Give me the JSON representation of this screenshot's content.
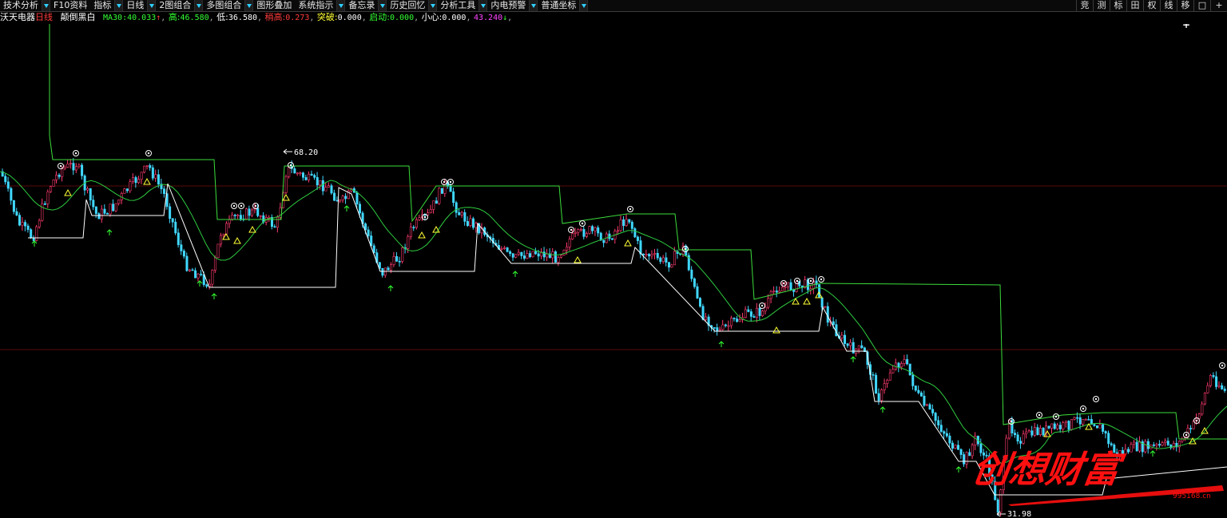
{
  "menu": [
    {
      "label": "技术分析",
      "dd": true
    },
    {
      "label": "F10资料",
      "dd": false
    },
    {
      "label": "指标",
      "dd": true
    },
    {
      "label": "日线",
      "dd": true
    },
    {
      "label": "2图组合",
      "dd": true
    },
    {
      "label": "多图组合",
      "dd": true
    },
    {
      "label": "图形叠加",
      "dd": false
    },
    {
      "label": "系统指示",
      "dd": true
    },
    {
      "label": "备忘录",
      "dd": true
    },
    {
      "label": "历史回忆",
      "dd": true
    },
    {
      "label": "分析工具",
      "dd": true
    },
    {
      "label": "内电预警",
      "dd": true
    },
    {
      "label": "普通坐标",
      "dd": true
    }
  ],
  "right_tools": [
    "竞",
    "测",
    "标",
    "田",
    "权",
    "线",
    "移",
    "□",
    "+"
  ],
  "info": {
    "stock": "沃天电器",
    "period": "日线",
    "formula": "颠倒黑白",
    "ma30_label": "MA30:",
    "ma30_value": "40.033",
    "ma30_arrow": "↑",
    "high_label": "高:",
    "high_value": "46.580",
    "low_label": "低:",
    "low_value": "36.580",
    "shaogao_label": "稍高:",
    "shaogao_value": "0.273",
    "tupo_label": "突破:",
    "tupo_value": "0.000",
    "qidong_label": "启动:",
    "qidong_value": "0.000",
    "xiaoxin_label": "小心:",
    "xiaoxin_value": "0.000",
    "last_value": "43.240",
    "last_arrow": "↓"
  },
  "annotations": {
    "max_price": "68.20",
    "min_price": "31.98",
    "cursor": "+"
  },
  "watermark": {
    "brand": "创想财富",
    "site": "995168.cn"
  },
  "colors": {
    "bg": "#000000",
    "up": "#ff3b6f",
    "down": "#40d8ff",
    "ma": "#2ecc40",
    "high_step": "#3cdc3c",
    "low_step": "#ffffff",
    "grid": "#5a0a0a",
    "label_yellow": "#ffff33",
    "label_red": "#ff3b3b",
    "label_green": "#33ff33",
    "label_magenta": "#ff44ff",
    "watermark_red": "#ff1010"
  }
}
